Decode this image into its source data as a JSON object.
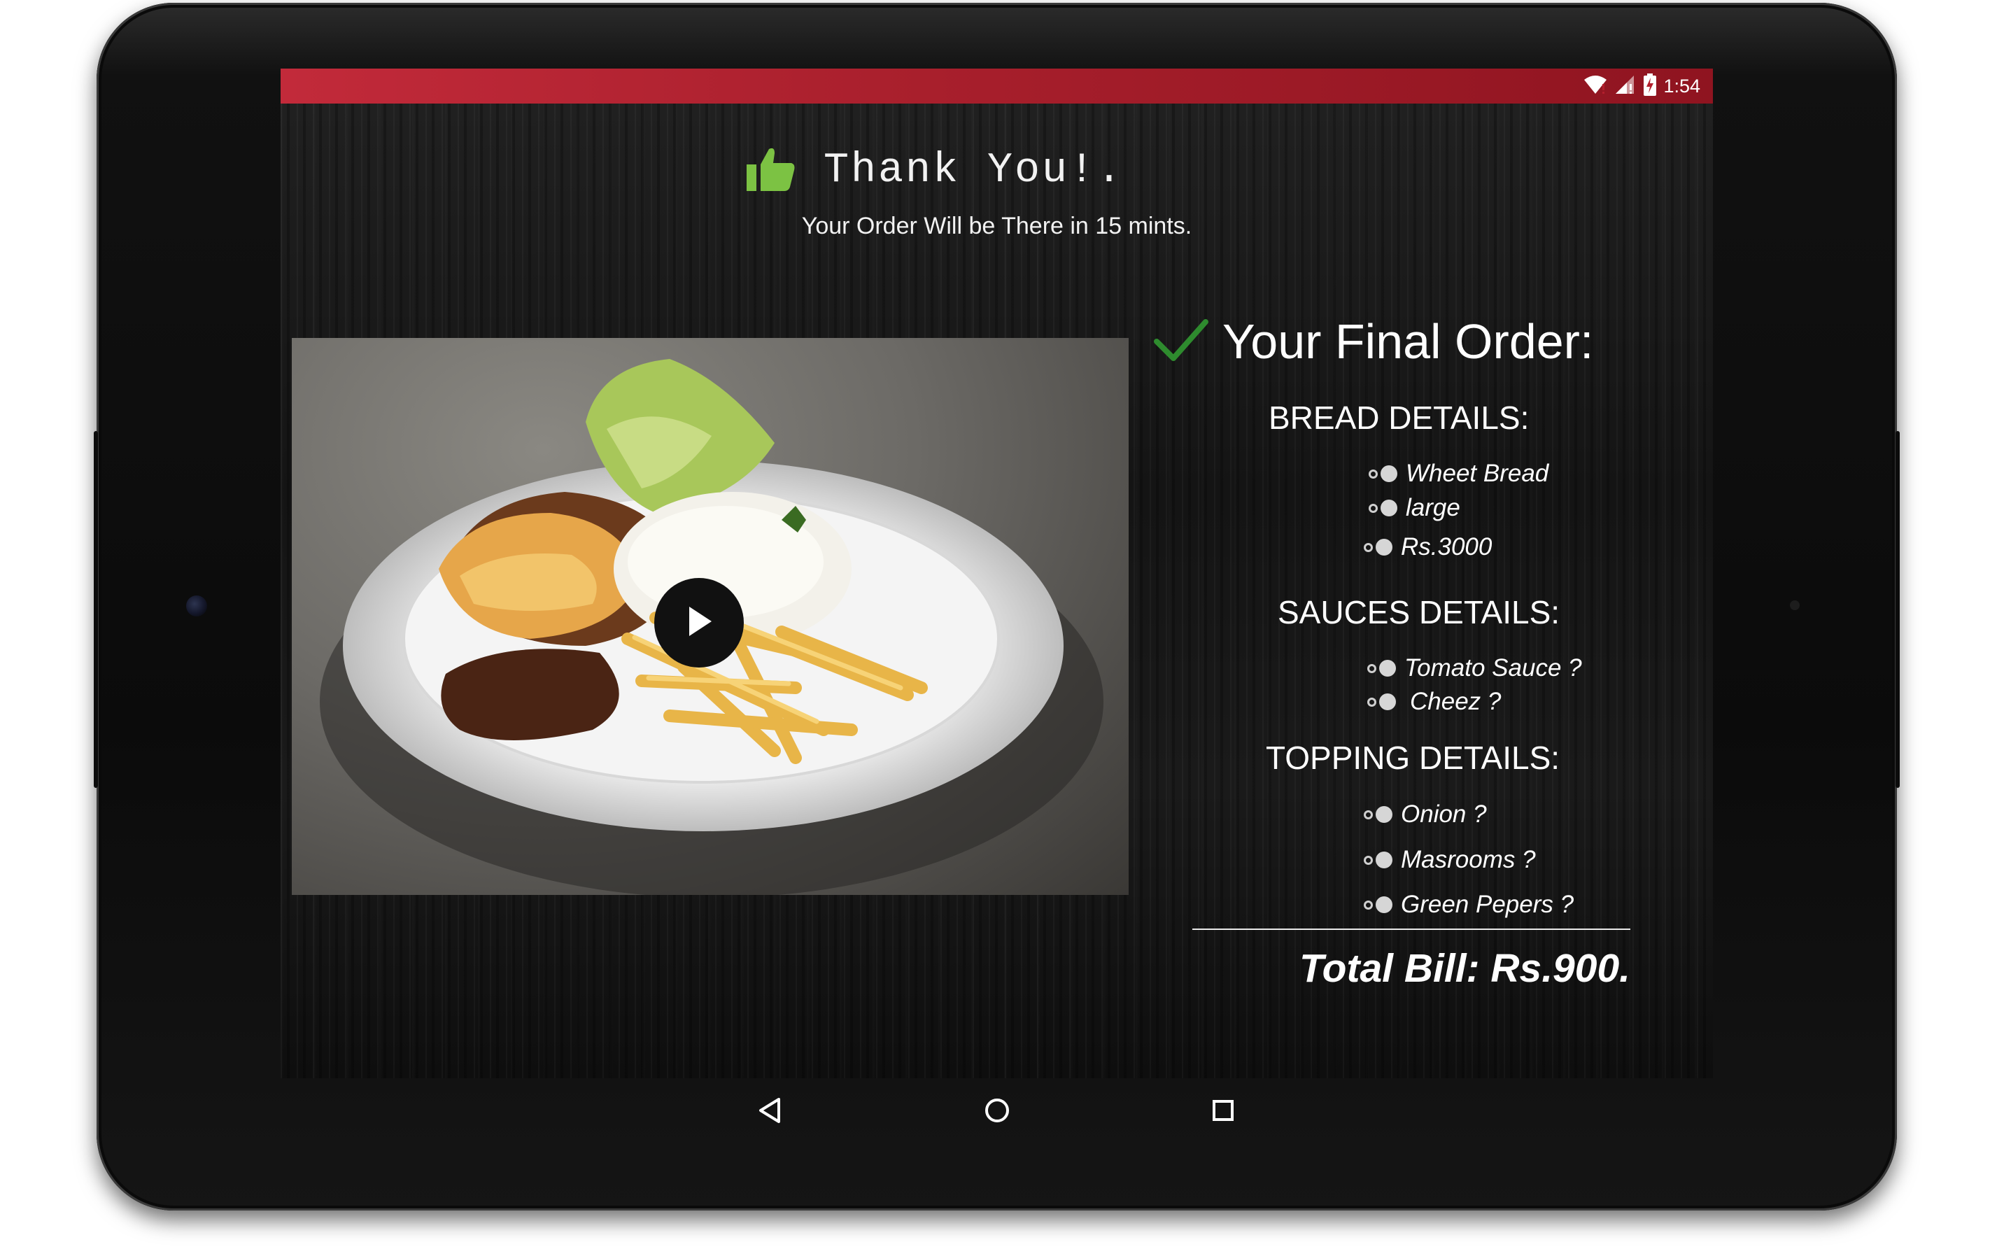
{
  "status_bar": {
    "time": "1:54",
    "icons": [
      "wifi-icon",
      "signal-icon",
      "battery-charging-icon"
    ],
    "color": "#b21e2c"
  },
  "header": {
    "icon": "thumbs-up-icon",
    "title": "Thank You!.",
    "subtitle": "Your Order Will be There in 15 mints."
  },
  "media": {
    "image": "food-plate-photo",
    "play_icon": "play-icon"
  },
  "order": {
    "check_icon": "checkmark-icon",
    "heading": "Your Final Order:",
    "bread": {
      "heading": "BREAD DETAILS:",
      "items": [
        "Wheet Bread",
        "large",
        "Rs.3000"
      ]
    },
    "sauces": {
      "heading": "SAUCES DETAILS:",
      "items": [
        "Tomato Sauce ?",
        "Cheez ?"
      ]
    },
    "toppings": {
      "heading": "TOPPING DETAILS:",
      "items": [
        "Onion ?",
        "Masrooms ?",
        "Green Pepers ?"
      ]
    },
    "total": "Total Bill: Rs.900."
  },
  "nav_bar": {
    "buttons": [
      "back-icon",
      "home-icon",
      "recents-icon"
    ]
  },
  "colors": {
    "accent_green": "#7cc243",
    "check_green": "#2e8b2e",
    "status_red": "#b21e2c"
  }
}
